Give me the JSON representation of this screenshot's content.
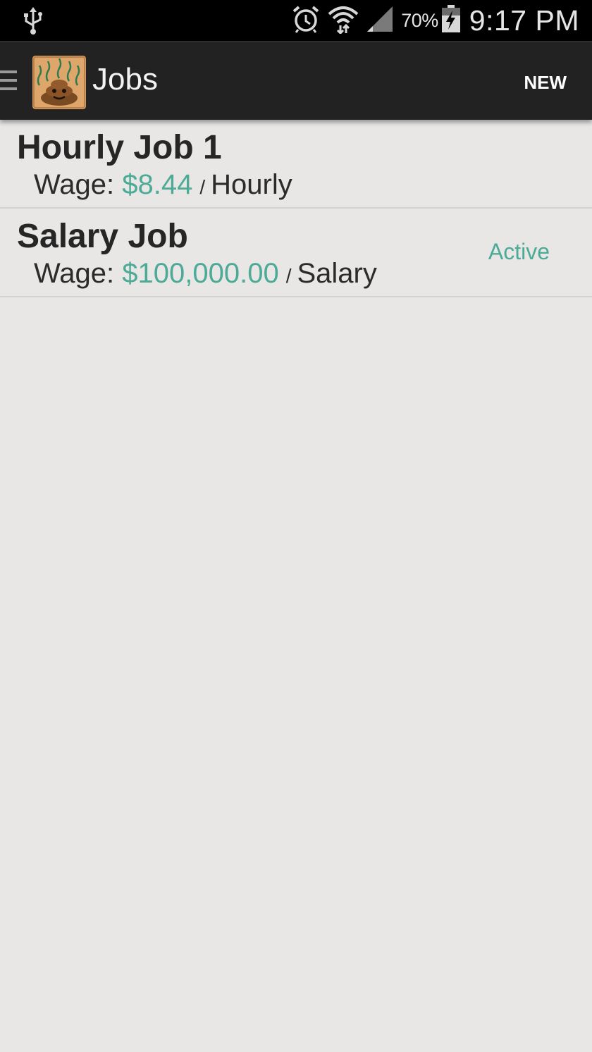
{
  "status_bar": {
    "battery_percent": "70%",
    "time": "9:17 PM",
    "icons": [
      "usb-icon",
      "alarm-icon",
      "wifi-icon",
      "signal-icon",
      "battery-charging-icon"
    ]
  },
  "action_bar": {
    "title": "Jobs",
    "new_label": "NEW"
  },
  "jobs": [
    {
      "name": "Hourly Job 1",
      "wage_label": "Wage:",
      "wage_amount": "$8.44",
      "separator": "/",
      "wage_type": "Hourly",
      "status": ""
    },
    {
      "name": "Salary Job",
      "wage_label": "Wage:",
      "wage_amount": "$100,000.00",
      "separator": "/",
      "wage_type": "Salary",
      "status": "Active"
    }
  ],
  "colors": {
    "accent": "#4caa97",
    "action_bar": "#222222",
    "background": "#e8e7e5"
  }
}
